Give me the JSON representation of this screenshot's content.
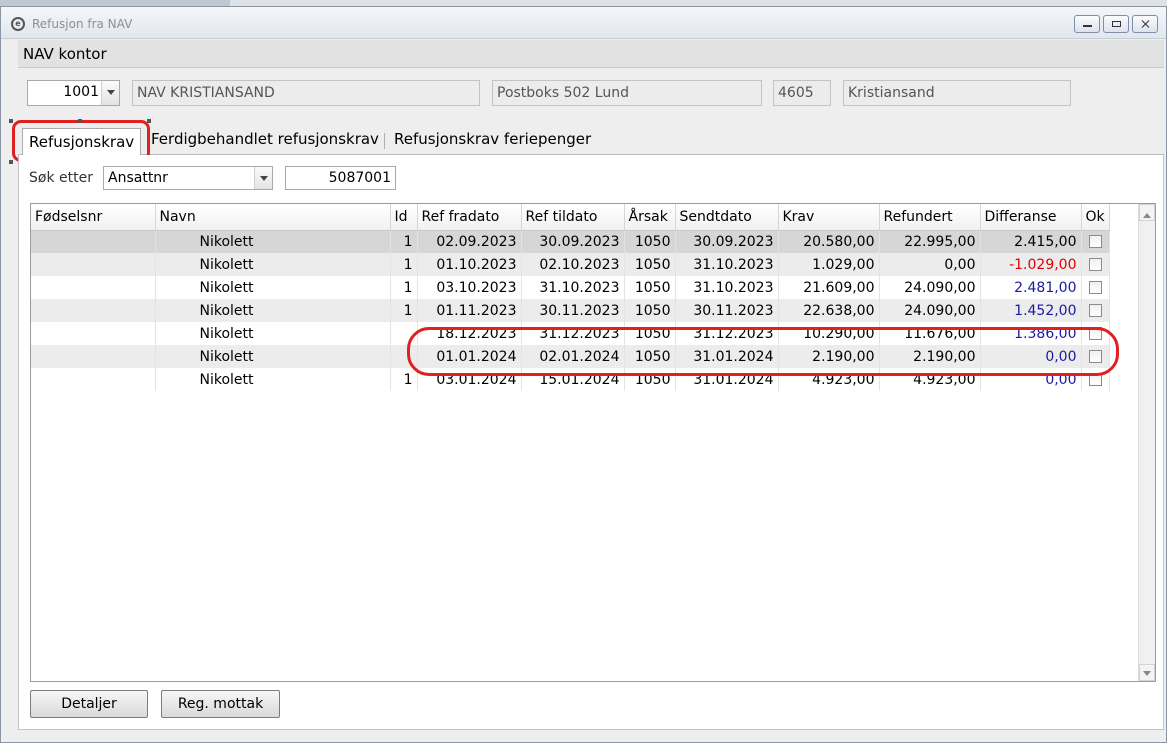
{
  "window": {
    "title": "Refusjon fra NAV"
  },
  "nav_kontor": {
    "header": "NAV kontor",
    "office_number": "1001",
    "office_name": "NAV KRISTIANSAND",
    "address": "Postboks 502 Lund",
    "postal_code": "4605",
    "city": "Kristiansand"
  },
  "tabs": [
    {
      "label": "Refusjonskrav",
      "active": true
    },
    {
      "label": "Ferdigbehandlet refusjonskrav",
      "active": false
    },
    {
      "label": "Refusjonskrav feriepenger",
      "active": false
    }
  ],
  "search": {
    "label": "Søk etter",
    "field": "Ansattnr",
    "value": "5087001"
  },
  "table": {
    "columns": [
      "Fødselsnr",
      "Navn",
      "Id",
      "Ref fradato",
      "Ref tildato",
      "Årsak",
      "Sendtdato",
      "Krav",
      "Refundert",
      "Differanse",
      "Ok"
    ],
    "rows": [
      {
        "navn": "Nikolett",
        "id": "1",
        "fra": "02.09.2023",
        "til": "30.09.2023",
        "arsak": "1050",
        "sendt": "30.09.2023",
        "krav": "20.580,00",
        "refundert": "22.995,00",
        "diff": "2.415,00",
        "diff_color": "black"
      },
      {
        "navn": "Nikolett",
        "id": "1",
        "fra": "01.10.2023",
        "til": "02.10.2023",
        "arsak": "1050",
        "sendt": "31.10.2023",
        "krav": "1.029,00",
        "refundert": "0,00",
        "diff": "-1.029,00",
        "diff_color": "red"
      },
      {
        "navn": "Nikolett",
        "id": "1",
        "fra": "03.10.2023",
        "til": "31.10.2023",
        "arsak": "1050",
        "sendt": "31.10.2023",
        "krav": "21.609,00",
        "refundert": "24.090,00",
        "diff": "2.481,00",
        "diff_color": "blue"
      },
      {
        "navn": "Nikolett",
        "id": "1",
        "fra": "01.11.2023",
        "til": "30.11.2023",
        "arsak": "1050",
        "sendt": "30.11.2023",
        "krav": "22.638,00",
        "refundert": "24.090,00",
        "diff": "1.452,00",
        "diff_color": "blue"
      },
      {
        "navn": "Nikolett",
        "id": "",
        "fra": "18.12.2023",
        "til": "31.12.2023",
        "arsak": "1050",
        "sendt": "31.12.2023",
        "krav": "10.290,00",
        "refundert": "11.676,00",
        "diff": "1.386,00",
        "diff_color": "blue"
      },
      {
        "navn": "Nikolett",
        "id": "",
        "fra": "01.01.2024",
        "til": "02.01.2024",
        "arsak": "1050",
        "sendt": "31.01.2024",
        "krav": "2.190,00",
        "refundert": "2.190,00",
        "diff": "0,00",
        "diff_color": "blue"
      },
      {
        "navn": "Nikolett",
        "id": "1",
        "fra": "03.01.2024",
        "til": "15.01.2024",
        "arsak": "1050",
        "sendt": "31.01.2024",
        "krav": "4.923,00",
        "refundert": "4.923,00",
        "diff": "0,00",
        "diff_color": "blue"
      }
    ]
  },
  "buttons": {
    "details": "Detaljer",
    "reg_mottak": "Reg. mottak"
  },
  "colors": {
    "annotation": "#e0211f",
    "negative": "#e00000",
    "positive": "#1a1aa0"
  }
}
